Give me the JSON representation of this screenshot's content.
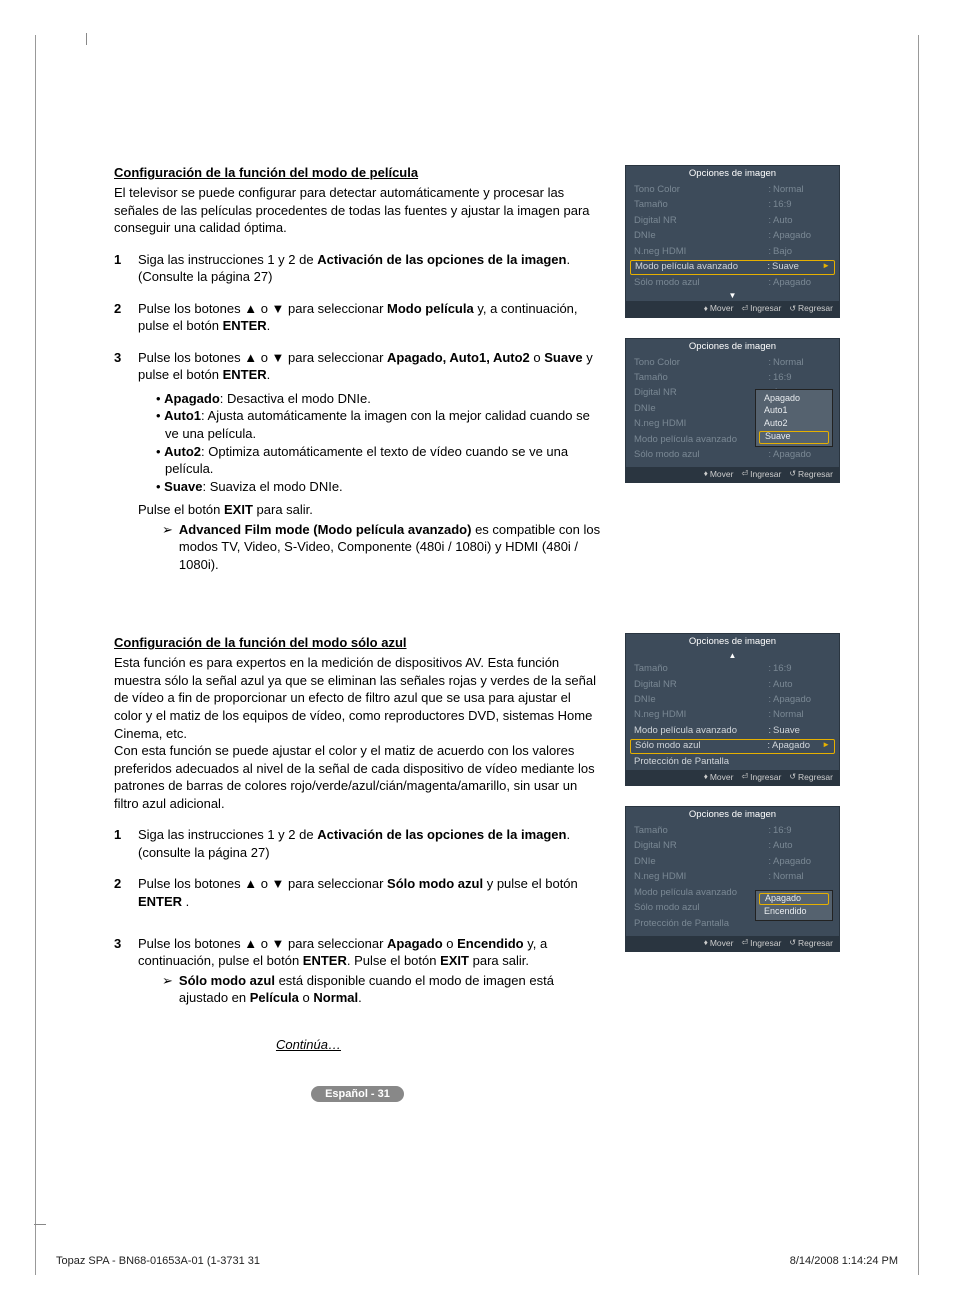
{
  "section1": {
    "title": "Configuración de la función del modo de película",
    "intro": "El televisor se puede configurar para detectar automáticamente y procesar las señales de las películas procedentes de todas las fuentes y ajustar la imagen para conseguir una calidad óptima.",
    "step1_a": "Siga las instrucciones 1 y 2 de ",
    "step1_b": "Activación de las opciones de la imagen",
    "step1_c": ". (Consulte la página 27)",
    "step2_a": "Pulse los botones ▲ o ▼ para seleccionar ",
    "step2_b": "Modo película",
    "step2_c": " y, a continuación, pulse el botón ",
    "step2_d": "ENTER",
    "step2_e": ".",
    "step3_a": "Pulse los botones ▲ o ▼ para seleccionar ",
    "step3_b": "Apagado, Auto1, Auto2",
    "step3_c": " o ",
    "step3_d": "Suave",
    "step3_e": " y pulse el botón ",
    "step3_f": "ENTER",
    "step3_g": ".",
    "b_apagado_l": "Apagado",
    "b_apagado_t": ": Desactiva el modo DNIe.",
    "b_auto1_l": "Auto1",
    "b_auto1_t": ": Ajusta automáticamente la imagen con la mejor calidad cuando se ve una película.",
    "b_auto2_l": "Auto2",
    "b_auto2_t": ": Optimiza automáticamente el texto de vídeo cuando se ve una película.",
    "b_suave_l": "Suave",
    "b_suave_t": ": Suaviza el modo DNIe.",
    "exit_a": "Pulse el botón ",
    "exit_b": "EXIT",
    "exit_c": " para salir.",
    "note_a": "Advanced Film mode (Modo película avanzado)",
    "note_b": " es compatible con los modos TV, Video, S-Video, Componente (480i / 1080i) y HDMI (480i / 1080i)."
  },
  "section2": {
    "title": "Configuración de la función del modo sólo azul",
    "intro": "Esta función es para expertos en la medición de dispositivos AV. Esta función muestra sólo la señal azul ya que se eliminan las señales rojas y verdes de la señal de vídeo a fin de proporcionar un efecto de filtro azul que se usa para ajustar el color y el matiz de los equipos de vídeo, como reproductores DVD, sistemas Home Cinema, etc.\nCon esta función se puede ajustar el color y el matiz de acuerdo con los valores preferidos adecuados al nivel de la señal de cada dispositivo de vídeo mediante los patrones de barras de colores rojo/verde/azul/cián/magenta/amarillo, sin usar un filtro azul adicional.",
    "step1_a": "Siga las instrucciones 1 y 2 de ",
    "step1_b": "Activación de las opciones de la imagen",
    "step1_c": ". (consulte la página 27)",
    "step2_a": "Pulse los botones ▲ o ▼ para seleccionar ",
    "step2_b": "Sólo modo azul",
    "step2_c": " y pulse el botón ",
    "step2_d": "ENTER",
    "step2_e": " .",
    "step3_a": "Pulse los botones ▲ o ▼ para seleccionar ",
    "step3_b": "Apagado",
    "step3_c": " o ",
    "step3_d": "Encendido",
    "step3_e": " y, a continuación, pulse el botón ",
    "step3_f": "ENTER",
    "step3_g": ". Pulse el botón ",
    "step3_h": "EXIT",
    "step3_i": " para salir.",
    "note_a": "Sólo modo azul",
    "note_b": " está disponible cuando el modo de imagen está ajustado en ",
    "note_c": "Película",
    "note_d": " o ",
    "note_e": "Normal",
    "note_f": "."
  },
  "osd": {
    "title": "Opciones de imagen",
    "tono": "Tono Color",
    "tono_v": "Normal",
    "tam": "Tamaño",
    "tam_v": "16:9",
    "dnr": "Digital NR",
    "dnr_v": "Auto",
    "dnie": "DNIe",
    "dnie_v": "Apagado",
    "nneg": "N.neg HDMI",
    "nneg_v": "Bajo",
    "nneg_v2": "Normal",
    "mpa": "Modo película avanzado",
    "mpa_v": "Suave",
    "sma": "Sólo modo azul",
    "sma_v": "Apagado",
    "prot": "Protección de Pantalla",
    "popup1": [
      "Apagado",
      "Auto1",
      "Auto2",
      "Suave"
    ],
    "popup2": [
      "Apagado",
      "Encendido"
    ],
    "foot_mover": "Mover",
    "foot_ing": "Ingresar",
    "foot_reg": "Regresar"
  },
  "continua": "Continúa…",
  "pagebadge": "Español - 31",
  "footer_left": "Topaz SPA - BN68-01653A-01 (1-3731   31",
  "footer_right": "8/14/2008   1:14:24 PM"
}
